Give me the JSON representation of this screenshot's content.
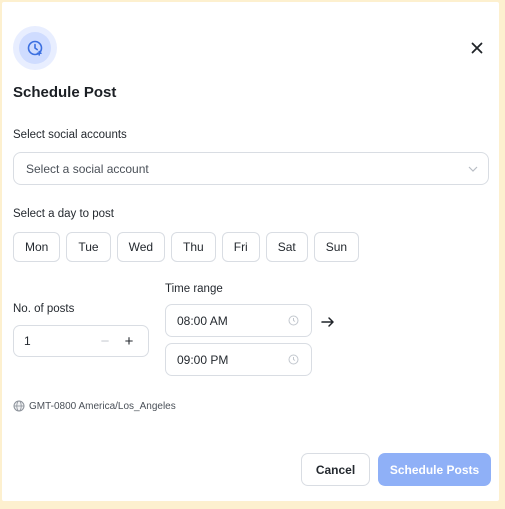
{
  "modal": {
    "title": "Schedule Post",
    "header_icon": "clock-plus-icon",
    "close_icon": "close-icon"
  },
  "accounts": {
    "label": "Select social accounts",
    "placeholder": "Select a social account",
    "dropdown_icon": "chevron-down-icon"
  },
  "days": {
    "label": "Select a day to post",
    "items": [
      "Mon",
      "Tue",
      "Wed",
      "Thu",
      "Fri",
      "Sat",
      "Sun"
    ]
  },
  "posts": {
    "label": "No. of posts",
    "value": "1",
    "minus": "−",
    "plus": "+"
  },
  "time_range": {
    "label": "Time range",
    "start": "08:00 AM",
    "end": "09:00 PM",
    "arrow_icon": "arrow-right-icon",
    "clock_icon": "clock-icon"
  },
  "timezone": {
    "icon": "globe-icon",
    "text": "GMT-0800 America/Los_Angeles"
  },
  "footer": {
    "cancel_label": "Cancel",
    "schedule_label": "Schedule Posts"
  },
  "colors": {
    "backdrop": "#fdf0cf",
    "primary_disabled": "#8fb0f7",
    "icon_accent": "#3b6fe0",
    "border": "#d9dde3"
  }
}
